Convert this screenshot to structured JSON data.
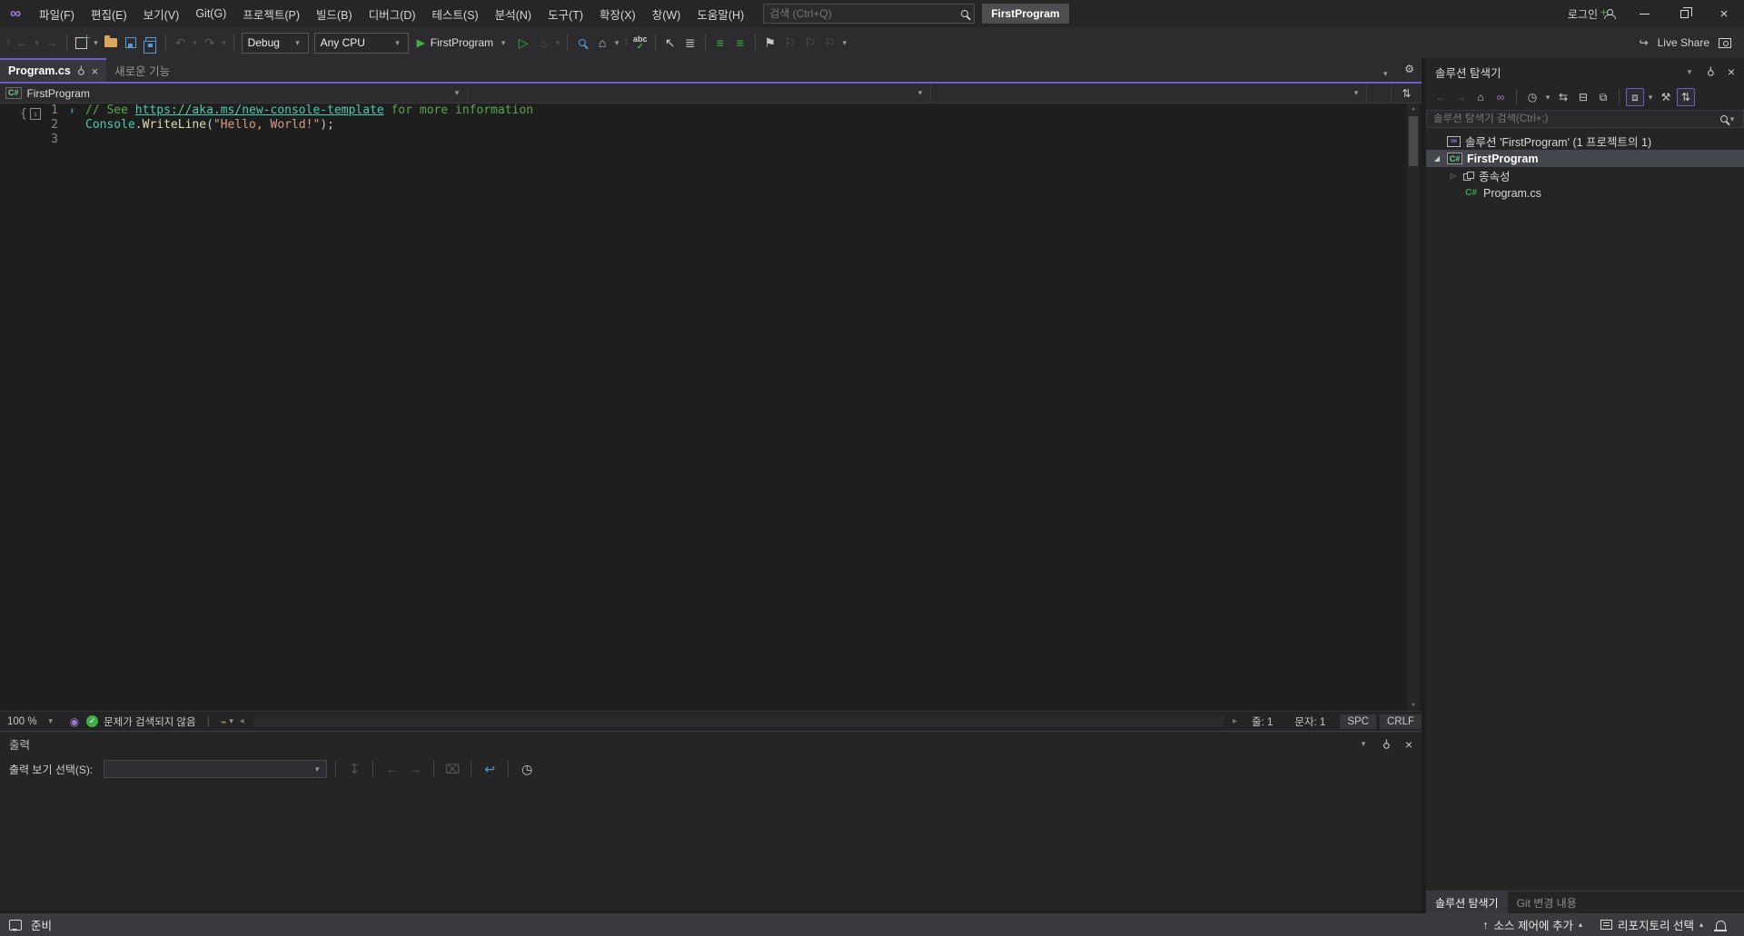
{
  "icons": {
    "infinity": "∞",
    "dropdown": "▾",
    "back": "←",
    "forward": "→",
    "undo": "↶",
    "redo": "↷",
    "play": "▶",
    "play_outline": "▷",
    "flame": "♨",
    "home": "⌂",
    "sync": "⇆",
    "collapse_all": "⊟",
    "show_all_files": "⧉",
    "nesting": "⧈",
    "wrench": "⚒",
    "pin": "⚲",
    "close": "×",
    "gear": "⚙",
    "bookmark": "⚑",
    "bookmark_prev": "⚐",
    "bookmark_next": "⚐",
    "bookmark_clear": "⚐",
    "clock": "◷",
    "check": "✓",
    "scroll_left": "◂",
    "scroll_right": "▸",
    "up_arrow": "↑",
    "caret_up": "▴",
    "word_wrap": "↩",
    "clear_all": "⌧",
    "find_message": "↧",
    "split": "⇅",
    "screwdriver": "⌁",
    "live_share": "↪",
    "cursor": "↖",
    "paste_format": "≣",
    "indent_in": "≡",
    "indent_out": "≡",
    "pulse": "◉",
    "csharp": "C#",
    "abc_label": "abc",
    "pending_filter": "◷",
    "search_dd": "▾",
    "expanded": "◢",
    "collapsed": "▷",
    "om_brace": "{",
    "om_arrow": "↴"
  },
  "titlebar": {
    "menus": [
      "파일(F)",
      "편집(E)",
      "보기(V)",
      "Git(G)",
      "프로젝트(P)",
      "빌드(B)",
      "디버그(D)",
      "테스트(S)",
      "분석(N)",
      "도구(T)",
      "확장(X)",
      "창(W)",
      "도움말(H)"
    ],
    "search_placeholder": "검색 (Ctrl+Q)",
    "project_badge": "FirstProgram",
    "signin_label": "로그인"
  },
  "toolbar": {
    "config": "Debug",
    "platform": "Any CPU",
    "run_target": "FirstProgram",
    "live_share_label": "Live Share"
  },
  "editor": {
    "tabs": [
      {
        "label": "Program.cs",
        "active": true
      },
      {
        "label": "새로운 기능",
        "active": false
      }
    ],
    "navbar": {
      "project": "FirstProgram"
    },
    "lines": [
      {
        "num": "1",
        "quickaction": true,
        "segments": [
          {
            "t": "// See ",
            "c": "comment"
          },
          {
            "t": "https://aka.ms/new-console-template",
            "c": "link"
          },
          {
            "t": " for more information",
            "c": "comment"
          }
        ]
      },
      {
        "num": "2",
        "quickaction": false,
        "segments": [
          {
            "t": "Console",
            "c": "class"
          },
          {
            "t": ".",
            "c": "punct"
          },
          {
            "t": "WriteLine",
            "c": "method"
          },
          {
            "t": "(",
            "c": "punct"
          },
          {
            "t": "\"Hello, World!\"",
            "c": "string"
          },
          {
            "t": ");",
            "c": "punct"
          }
        ]
      },
      {
        "num": "3",
        "quickaction": false,
        "segments": []
      }
    ],
    "status": {
      "zoom": "100 %",
      "health_message": "문제가 검색되지 않음",
      "line_label": "줄: 1",
      "column_label": "문자: 1",
      "space_mode": "SPC",
      "eol_mode": "CRLF"
    }
  },
  "solution_explorer": {
    "title": "솔루션 탐색기",
    "search_placeholder": "솔루션 탐색기 검색(Ctrl+;)",
    "tree": [
      {
        "label": "솔루션 'FirstProgram' (1 프로젝트의 1)",
        "icon": "solution",
        "indent": 0,
        "expander": "",
        "selected": false,
        "bold": false
      },
      {
        "label": "FirstProgram",
        "icon": "csharp-project",
        "indent": 0,
        "expander": "expanded",
        "selected": true,
        "bold": true
      },
      {
        "label": "종속성",
        "icon": "dependencies",
        "indent": 1,
        "expander": "collapsed",
        "selected": false,
        "bold": false
      },
      {
        "label": "Program.cs",
        "icon": "csharp-file",
        "indent": 1,
        "expander": "",
        "selected": false,
        "bold": false
      }
    ],
    "bottom_tabs": [
      {
        "label": "솔루션 탐색기",
        "active": true
      },
      {
        "label": "Git 변경 내용",
        "active": false
      }
    ]
  },
  "output_panel": {
    "title": "출력",
    "selector_label": "출력 보기 선택(S):",
    "selector_value": ""
  },
  "statusbar": {
    "ready": "준비",
    "add_source_control": "소스 제어에 추가",
    "select_repo": "리포지토리 선택"
  },
  "colors": {
    "accent_purple": "#6b5ec9",
    "run_green": "#3fae46",
    "comment_green": "#57a64a",
    "string_orange": "#d69d85",
    "class_teal": "#4ec9b0",
    "status_gray": "#3b3b3f"
  }
}
